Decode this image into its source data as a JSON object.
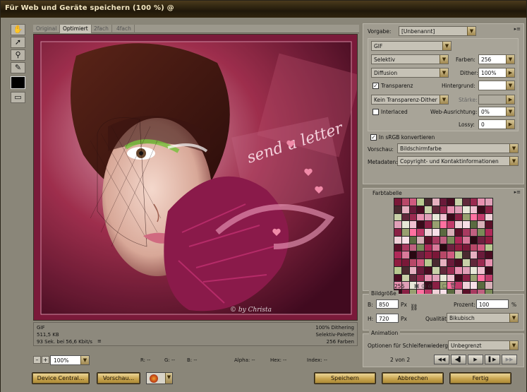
{
  "window": {
    "title": "Für Web und Geräte speichern (100 %) @"
  },
  "tools": [
    {
      "name": "hand-tool-icon",
      "glyph": "✋"
    },
    {
      "name": "slice-select-tool-icon",
      "glyph": "➚"
    },
    {
      "name": "zoom-tool-icon",
      "glyph": "⚲"
    },
    {
      "name": "eyedropper-tool-icon",
      "glyph": "✎"
    },
    {
      "name": "eyedropper-color-swatch",
      "glyph": ""
    },
    {
      "name": "toggle-slices-icon",
      "glyph": "▭"
    }
  ],
  "tabs": [
    "Original",
    "Optimiert",
    "2fach",
    "4fach"
  ],
  "active_tab": "Optimiert",
  "canvas": {
    "watermark_left": "© by Christa",
    "art_text": "send a letter"
  },
  "info": {
    "format": "GIF",
    "size": "511,5 KB",
    "time": "93 Sek. bei 56,6 Kbit/s",
    "dither": "100% Dithering",
    "palette": "Selektiv-Palette",
    "colors": "256 Farben"
  },
  "status": {
    "zoom": "100%",
    "r": "R: --",
    "g": "G: --",
    "b": "B: --",
    "alpha": "Alpha: --",
    "hex": "Hex: --",
    "index": "Index: --"
  },
  "buttons": {
    "device_central": "Device Central...",
    "preview": "Vorschau...",
    "save": "Speichern",
    "cancel": "Abbrechen",
    "done": "Fertig"
  },
  "settings": {
    "preset_label": "Vorgabe:",
    "preset_value": "[Unbenannt]",
    "format_value": "GIF",
    "reduction": "Selektiv",
    "colors_label": "Farben:",
    "colors_value": "256",
    "dither_algo": "Diffusion",
    "dither_label": "Dither:",
    "dither_value": "100%",
    "transparency_label": "Transparenz",
    "transparency_checked": true,
    "matte_label": "Hintergrund:",
    "trans_dither": "Kein Transparenz-Dither",
    "amount_label": "Stärke:",
    "interlaced_label": "Interlaced",
    "interlaced_checked": false,
    "websnap_label": "Web-Ausrichtung:",
    "websnap_value": "0%",
    "lossy_label": "Lossy:",
    "lossy_value": "0",
    "srgb_label": "In sRGB konvertieren",
    "srgb_checked": true,
    "preview_label": "Vorschau:",
    "preview_value": "Bildschirmfarbe",
    "metadata_label": "Metadaten:",
    "metadata_value": "Copyright- und Kontaktinformationen"
  },
  "color_table": {
    "title": "Farbtabelle",
    "count": "256",
    "colors": [
      "#7a1838",
      "#c23a6a",
      "#e6b0c0",
      "#5a1028",
      "#9a2a50",
      "#d87a9a",
      "#3a0a1a",
      "#b84868",
      "#f0d0d8",
      "#6a1a3a",
      "#a83a60",
      "#e890b0",
      "#2a0812",
      "#8a2044",
      "#d05a80",
      "#f8e0e8",
      "#4a0c22",
      "#c06080",
      "#e0a0b8",
      "#6e2040",
      "#98a070",
      "#b8c890",
      "#5a6a40",
      "#c8d0a8",
      "#7a8a58",
      "#e8e8d8",
      "#901c40",
      "#ff70a0",
      "#4a2a30",
      "#d8b0b8",
      "#60283a",
      "#b02858",
      "#f0c0d0"
    ]
  },
  "image_size": {
    "title": "Bildgröße",
    "w_label": "B:",
    "w_value": "850",
    "w_unit": "Px",
    "h_label": "H:",
    "h_value": "720",
    "h_unit": "Px",
    "percent_label": "Prozent:",
    "percent_value": "100",
    "percent_unit": "%",
    "quality_label": "Qualität:",
    "quality_value": "Bikubisch"
  },
  "animation": {
    "title": "Animation",
    "loop_label": "Optionen für Schleifenwiedergabe:",
    "loop_value": "Unbegrenzt",
    "frame": "2 von 2"
  },
  "accent": "#c8a550"
}
